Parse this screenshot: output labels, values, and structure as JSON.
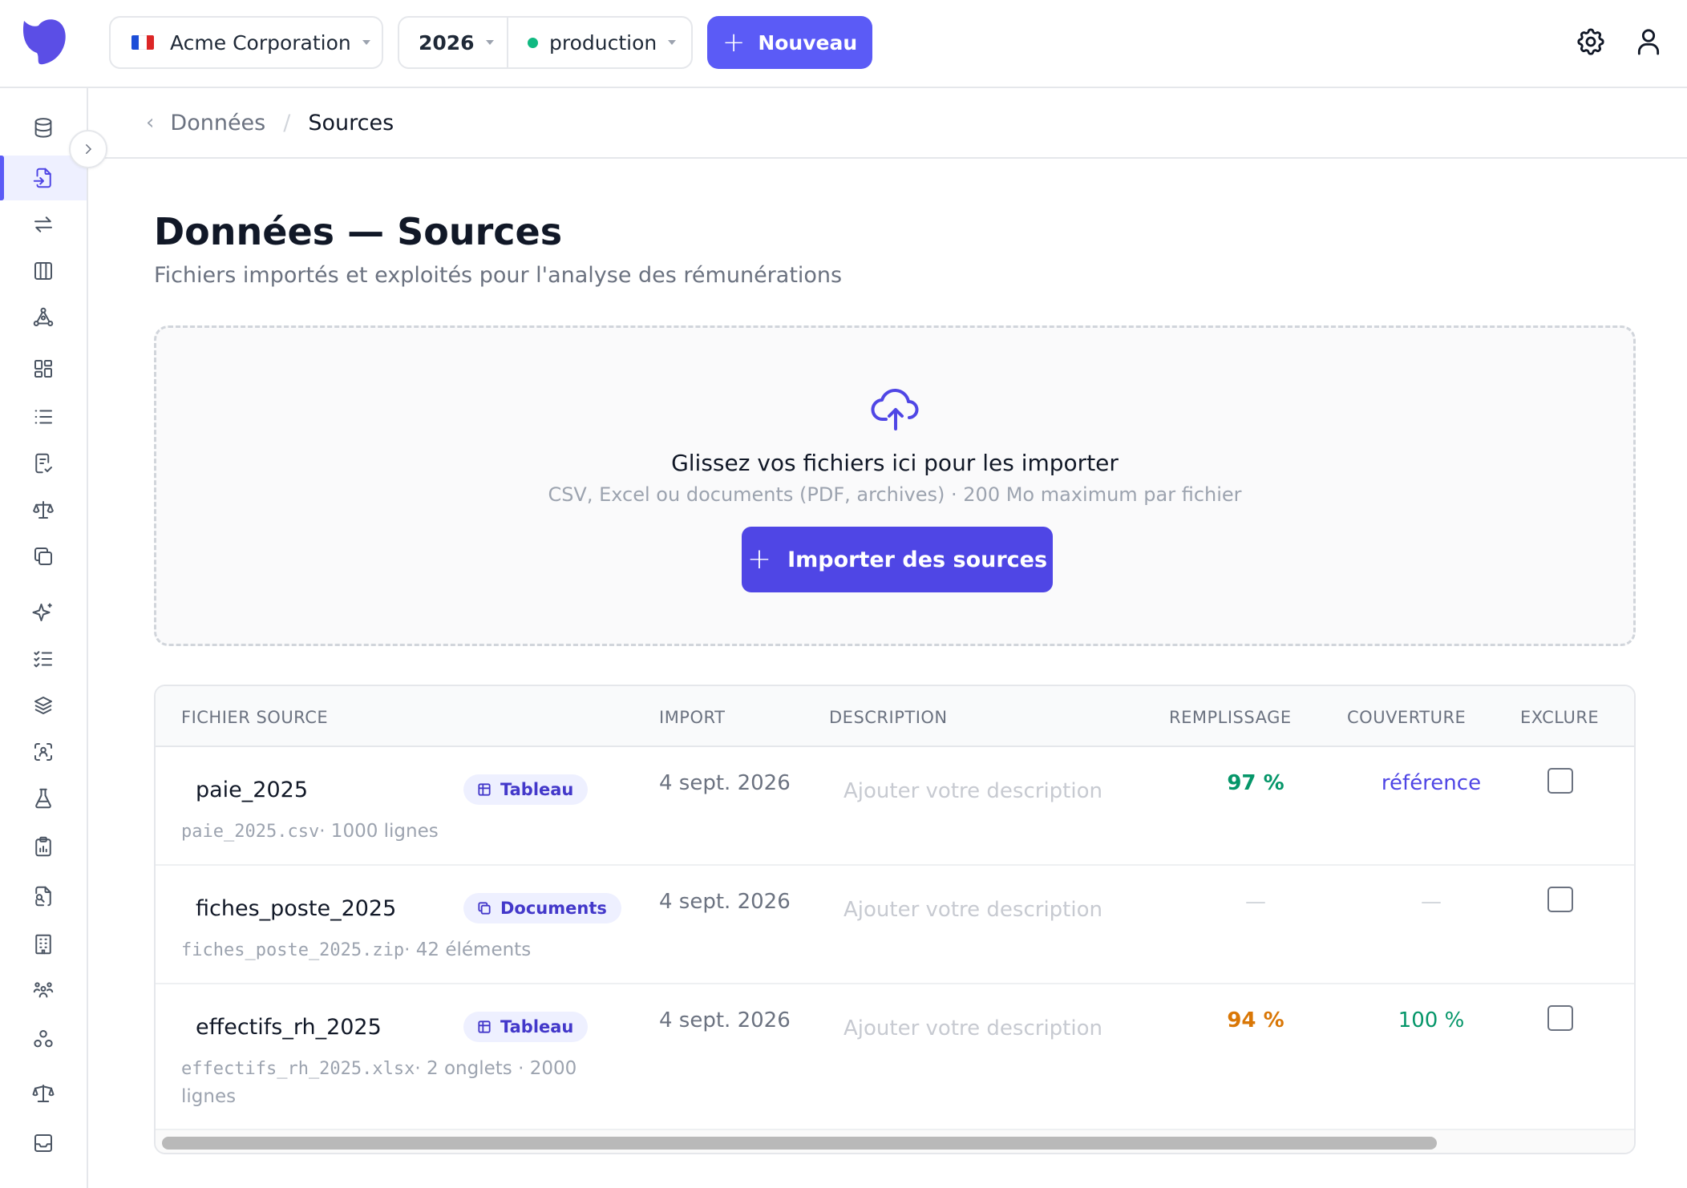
{
  "header": {
    "organization": "Acme Corporation",
    "flag_colors": [
      "#1d4ed8",
      "#ffffff",
      "#dc2626"
    ],
    "year": "2026",
    "environment": "production",
    "environment_color": "#10b981",
    "new_button": "Nouveau",
    "icons": [
      "logo-icon",
      "settings-gear-icon",
      "user-icon"
    ]
  },
  "sidebar": {
    "icons": [
      "database-icon",
      "file-import-icon",
      "arrows-exchange-icon",
      "columns-icon",
      "graph-nodes-icon",
      "dashboard-grid-icon",
      "list-icon",
      "document-check-icon",
      "scale-icon",
      "copy-icon",
      "sparkles-icon",
      "checklist-icon",
      "layers-icon",
      "scan-user-icon",
      "flask-icon",
      "clipboard-chart-icon",
      "file-search-icon",
      "building-icon",
      "users-group-icon",
      "org-chart-icon",
      "balance-icon",
      "inbox-icon"
    ],
    "active_index": 1
  },
  "breadcrumb": {
    "parent": "Données",
    "separator": "/",
    "current": "Sources"
  },
  "page": {
    "title": "Données — Sources",
    "subtitle": "Fichiers importés et exploités pour l'analyse des rémunérations"
  },
  "dropzone": {
    "title": "Glissez vos fichiers ici pour les importer",
    "hint": "CSV, Excel ou documents (PDF, archives) · 200 Mo maximum par fichier",
    "button": "Importer des sources"
  },
  "table": {
    "columns": {
      "file": "FICHIER SOURCE",
      "import": "IMPORT",
      "description": "DESCRIPTION",
      "fill": "REMPLISSAGE",
      "coverage": "COUVERTURE",
      "exclude": "EXCLURE"
    },
    "rows": [
      {
        "name": "paie_2025",
        "tag": "Tableau",
        "filename": "paie_2025.csv",
        "details": "· 1000 lignes",
        "import_date": "4 sept. 2026",
        "description_placeholder": "Ajouter votre description",
        "fill": "97 %",
        "coverage": "référence",
        "excluded": false
      },
      {
        "name": "fiches_poste_2025",
        "tag": "Documents",
        "filename": "fiches_poste_2025.zip",
        "details": "· 42 éléments",
        "import_date": "4 sept. 2026",
        "description_placeholder": "Ajouter votre description",
        "fill": "—",
        "coverage": "—",
        "excluded": false
      },
      {
        "name": "effectifs_rh_2025",
        "tag": "Tableau",
        "filename": "effectifs_rh_2025.xlsx",
        "details": "· 2 onglets · 2000 lignes",
        "import_date": "4 sept. 2026",
        "description_placeholder": "Ajouter votre description",
        "fill": "94 %",
        "coverage": "100 %",
        "excluded": false
      }
    ]
  },
  "colors": {
    "accent": "#5b5bf6",
    "accent_dark": "#4f46e5",
    "success": "#059669",
    "warning": "#d97706"
  }
}
